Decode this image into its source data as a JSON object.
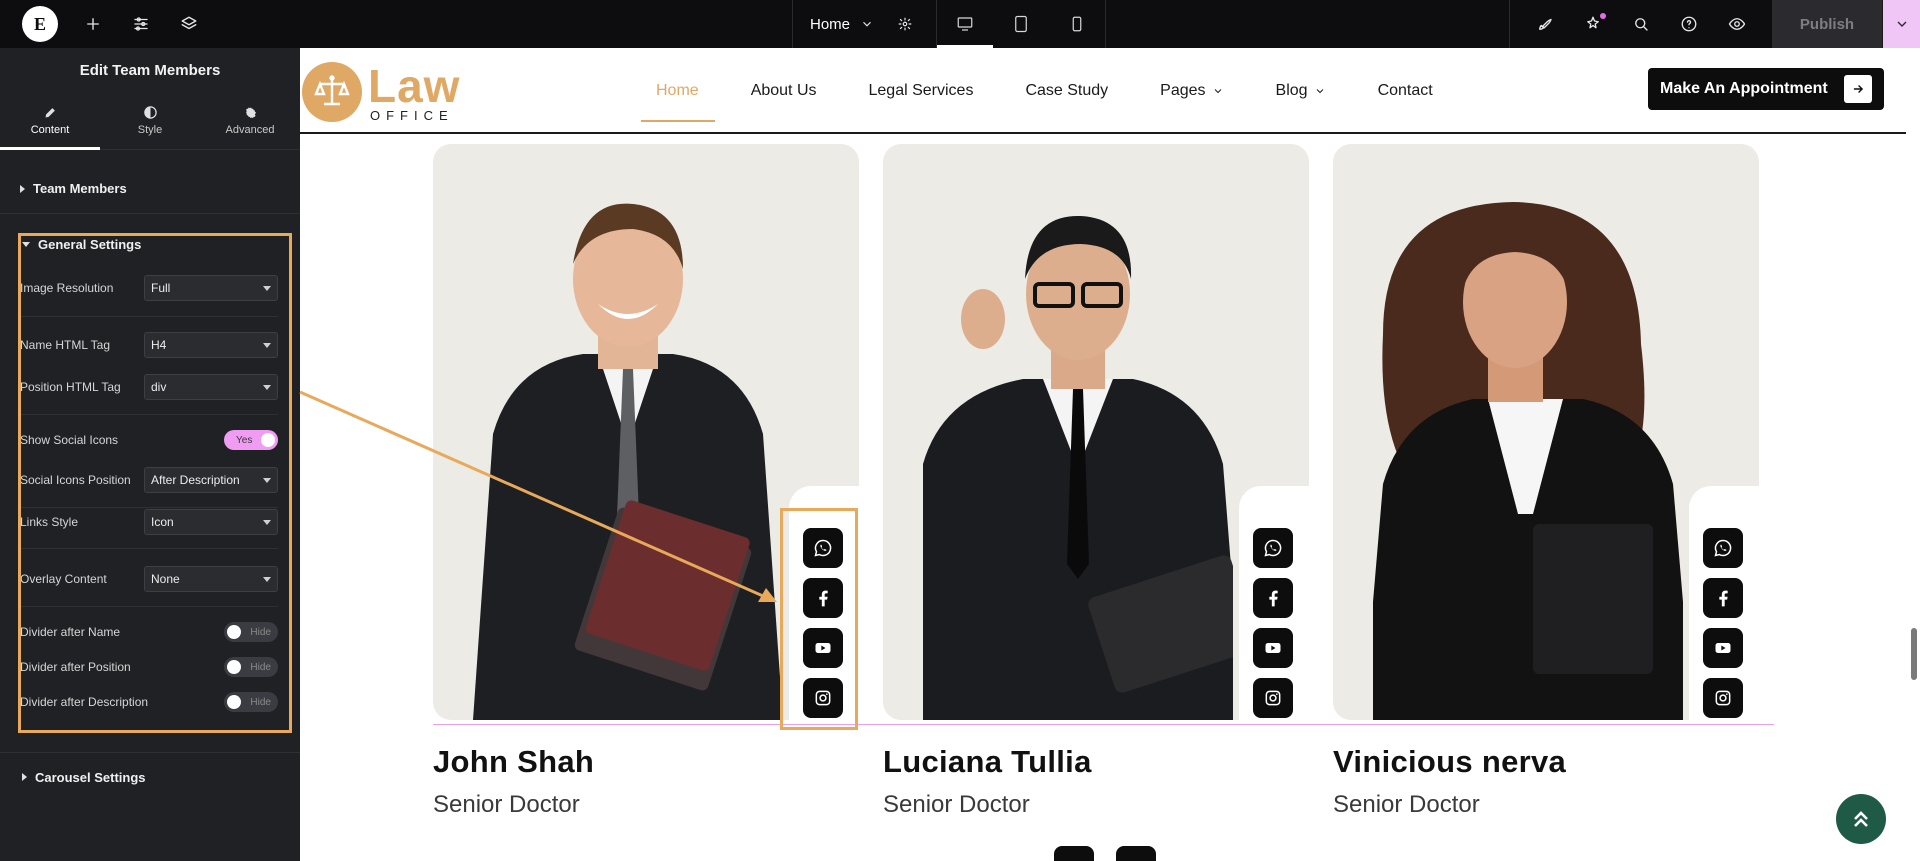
{
  "topbar": {
    "logo_letter": "E",
    "icons": [
      "plus-icon",
      "sliders-icon",
      "layers-icon"
    ],
    "page_selector": "Home",
    "devices": [
      "desktop-icon",
      "tablet-icon",
      "mobile-icon"
    ],
    "right_icons": [
      "rocket-icon",
      "notifications-icon",
      "search-icon",
      "help-icon",
      "preview-eye-icon"
    ],
    "publish_label": "Publish"
  },
  "sidebar": {
    "title": "Edit Team Members",
    "tabs": [
      {
        "label": "Content",
        "icon": "pencil-icon",
        "active": true
      },
      {
        "label": "Style",
        "icon": "contrast-icon",
        "active": false
      },
      {
        "label": "Advanced",
        "icon": "gear-icon",
        "active": false
      }
    ],
    "sections": {
      "team_members": "Team Members",
      "general_settings": "General Settings",
      "carousel_settings": "Carousel Settings"
    },
    "controls": {
      "image_resolution": {
        "label": "Image Resolution",
        "value": "Full"
      },
      "name_html_tag": {
        "label": "Name HTML Tag",
        "value": "H4"
      },
      "position_html_tag": {
        "label": "Position HTML Tag",
        "value": "div"
      },
      "show_social_icons": {
        "label": "Show Social Icons",
        "value": "Yes"
      },
      "social_icons_position": {
        "label": "Social Icons Position",
        "value": "After Description"
      },
      "links_style": {
        "label": "Links Style",
        "value": "Icon"
      },
      "overlay_content": {
        "label": "Overlay Content",
        "value": "None"
      },
      "divider_after_name": {
        "label": "Divider after Name",
        "value": "Hide"
      },
      "divider_after_position": {
        "label": "Divider after Position",
        "value": "Hide"
      },
      "divider_after_description": {
        "label": "Divider after Description",
        "value": "Hide"
      }
    }
  },
  "site": {
    "logo_main": "Law",
    "logo_sub": "OFFICE",
    "nav": [
      "Home",
      "About Us",
      "Legal Services",
      "Case Study",
      "Pages",
      "Blog",
      "Contact"
    ],
    "cta": "Make An Appointment"
  },
  "team": [
    {
      "name": "John Shah",
      "position": "Senior Doctor"
    },
    {
      "name": "Luciana Tullia",
      "position": "Senior Doctor"
    },
    {
      "name": "Vinicious nerva",
      "position": "Senior Doctor"
    }
  ],
  "social_icons": [
    "whatsapp-icon",
    "facebook-icon",
    "youtube-icon",
    "instagram-icon"
  ],
  "colors": {
    "accent_gold": "#e0a865",
    "highlight": "#e8a95a",
    "toggle_pink": "#f09cf2",
    "to_top_green": "#1f5a46"
  }
}
